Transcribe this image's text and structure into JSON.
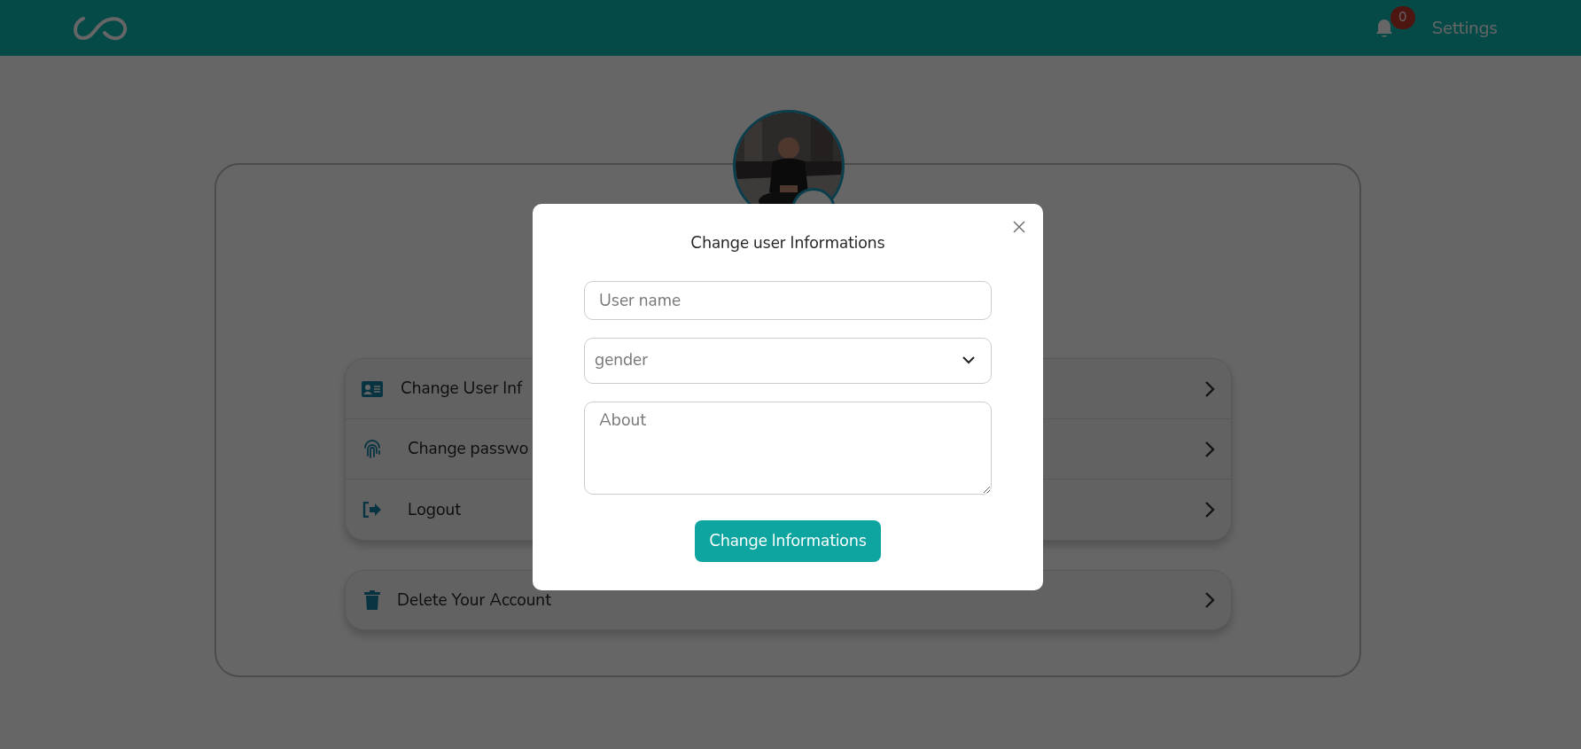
{
  "header": {
    "notification_count": "0",
    "settings_link": "Settings"
  },
  "menu_items": [
    {
      "kind": "user-info",
      "label": "Change User Inf"
    },
    {
      "kind": "password",
      "label": "Change passwo"
    },
    {
      "kind": "logout",
      "label": "Logout"
    }
  ],
  "danger_item": {
    "kind": "delete",
    "label": "Delete Your Account"
  },
  "modal": {
    "title": "Change user Informations",
    "fields": [
      {
        "kind": "text",
        "placeholder": "User name"
      },
      {
        "kind": "select",
        "placeholder": "gender"
      },
      {
        "kind": "textarea",
        "placeholder": "About"
      }
    ],
    "submit": "Change Informations"
  }
}
